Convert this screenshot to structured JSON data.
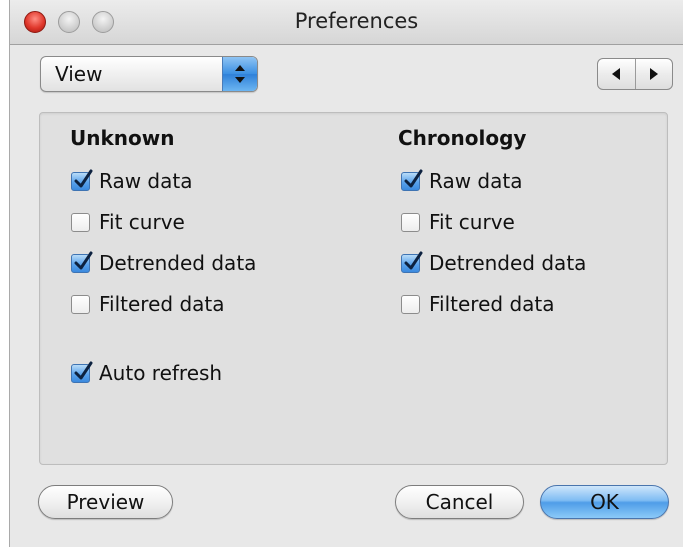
{
  "window": {
    "title": "Preferences"
  },
  "view_popup": {
    "selected": "View"
  },
  "groups": {
    "unknown": {
      "heading": "Unknown",
      "options": [
        {
          "label": "Raw data",
          "checked": true
        },
        {
          "label": "Fit curve",
          "checked": false
        },
        {
          "label": "Detrended data",
          "checked": true
        },
        {
          "label": "Filtered data",
          "checked": false
        }
      ],
      "auto_refresh": {
        "label": "Auto refresh",
        "checked": true
      }
    },
    "chronology": {
      "heading": "Chronology",
      "options": [
        {
          "label": "Raw data",
          "checked": true
        },
        {
          "label": "Fit curve",
          "checked": false
        },
        {
          "label": "Detrended data",
          "checked": true
        },
        {
          "label": "Filtered data",
          "checked": false
        }
      ]
    }
  },
  "buttons": {
    "preview": "Preview",
    "cancel": "Cancel",
    "ok": "OK"
  },
  "colors": {
    "accent": "#3b8fe3",
    "close": "#e0382c"
  },
  "icons": {
    "popup_arrows": "up-down-arrows-icon",
    "stepper_left": "triangle-left-icon",
    "stepper_right": "triangle-right-icon",
    "checkmark": "checkmark-icon"
  }
}
